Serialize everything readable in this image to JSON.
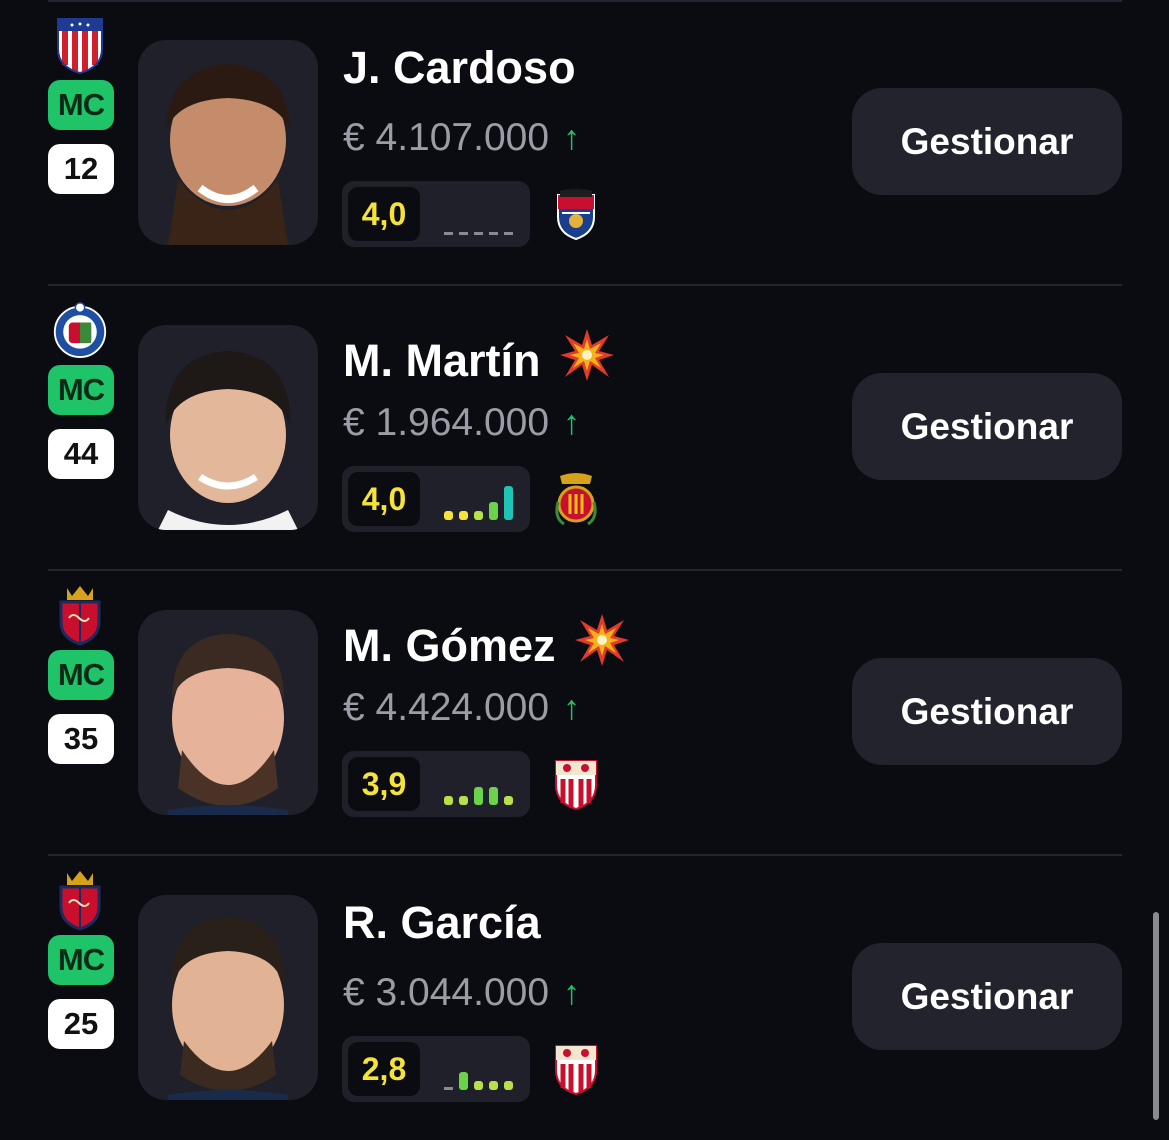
{
  "players": [
    {
      "club": "atletico-madrid",
      "position": "MC",
      "number": "12",
      "name": "J. Cardoso",
      "hot": false,
      "price": "€ 4.107.000",
      "trend": "↑",
      "score": "4,0",
      "form": [
        0,
        0,
        0,
        0,
        0
      ],
      "next_opponent": "levante",
      "button": "Gestionar"
    },
    {
      "club": "getafe",
      "position": "MC",
      "number": "44",
      "name": "M. Martín",
      "hot": true,
      "price": "€ 1.964.000",
      "trend": "↑",
      "score": "4,0",
      "form": [
        1,
        1,
        2,
        3,
        5
      ],
      "next_opponent": "mallorca",
      "button": "Gestionar"
    },
    {
      "club": "osasuna",
      "position": "MC",
      "number": "35",
      "name": "M. Gómez",
      "hot": true,
      "price": "€ 4.424.000",
      "trend": "↑",
      "score": "3,9",
      "form": [
        2,
        2,
        3,
        3,
        2
      ],
      "next_opponent": "sevilla",
      "button": "Gestionar"
    },
    {
      "club": "osasuna",
      "position": "MC",
      "number": "25",
      "name": "R. García",
      "hot": false,
      "price": "€ 3.044.000",
      "trend": "↑",
      "score": "2,8",
      "form": [
        0,
        3,
        2,
        2,
        2
      ],
      "next_opponent": "sevilla",
      "button": "Gestionar"
    }
  ],
  "colors": {
    "background": "#0b0b12",
    "card": "#1f2029",
    "position_badge": "#1ec467",
    "score_text": "#f6e33a",
    "trend_up": "#1ec467",
    "button_bg": "#22232c"
  },
  "icons": {
    "hot": "explosion-icon",
    "trend": "arrow-up-icon"
  }
}
